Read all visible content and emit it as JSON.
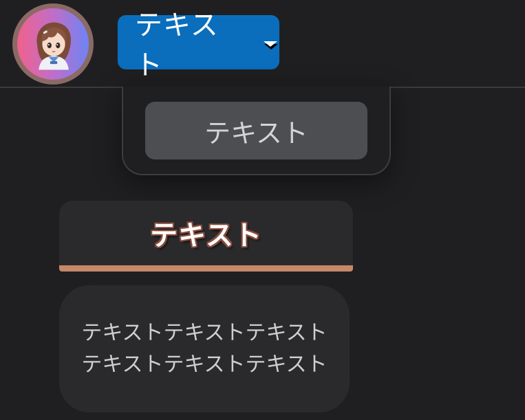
{
  "avatar": {
    "icon": "anime-character-avatar"
  },
  "dropdown": {
    "label": "テキスト",
    "caret_icon": "caret-down-icon",
    "accent_color": "#0a6ebd"
  },
  "menu": {
    "items": [
      {
        "label": "テキスト"
      }
    ]
  },
  "tab": {
    "label": "テキスト",
    "underline_color": "#c58868"
  },
  "card": {
    "lines": [
      "テキストテキストテキスト",
      "テキストテキストテキスト"
    ]
  }
}
